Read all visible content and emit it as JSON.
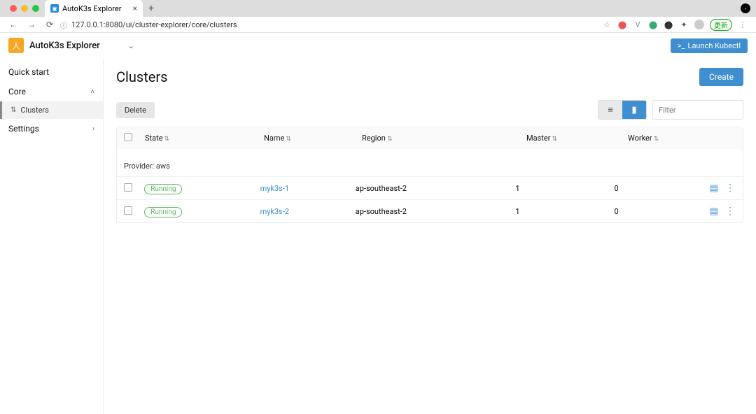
{
  "browser": {
    "tab_title": "AutoK3s Explorer",
    "url": "127.0.0.1:8080/ui/cluster-explorer/core/clusters",
    "update_label": "更新"
  },
  "header": {
    "app_title": "AutoK3s Explorer",
    "launch_label": "Launch Kubectl"
  },
  "sidebar": {
    "quick_start": "Quick start",
    "core": "Core",
    "clusters": "Clusters",
    "settings": "Settings"
  },
  "page": {
    "title": "Clusters",
    "create": "Create",
    "delete": "Delete",
    "filter_placeholder": "Filter"
  },
  "table": {
    "headers": {
      "state": "State",
      "name": "Name",
      "region": "Region",
      "master": "Master",
      "worker": "Worker"
    },
    "group_prefix": "Provider: ",
    "group_value": "aws",
    "rows": [
      {
        "state": "Running",
        "name": "myk3s-1",
        "region": "ap-southeast-2",
        "master": "1",
        "worker": "0"
      },
      {
        "state": "Running",
        "name": "myk3s-2",
        "region": "ap-southeast-2",
        "master": "1",
        "worker": "0"
      }
    ]
  }
}
